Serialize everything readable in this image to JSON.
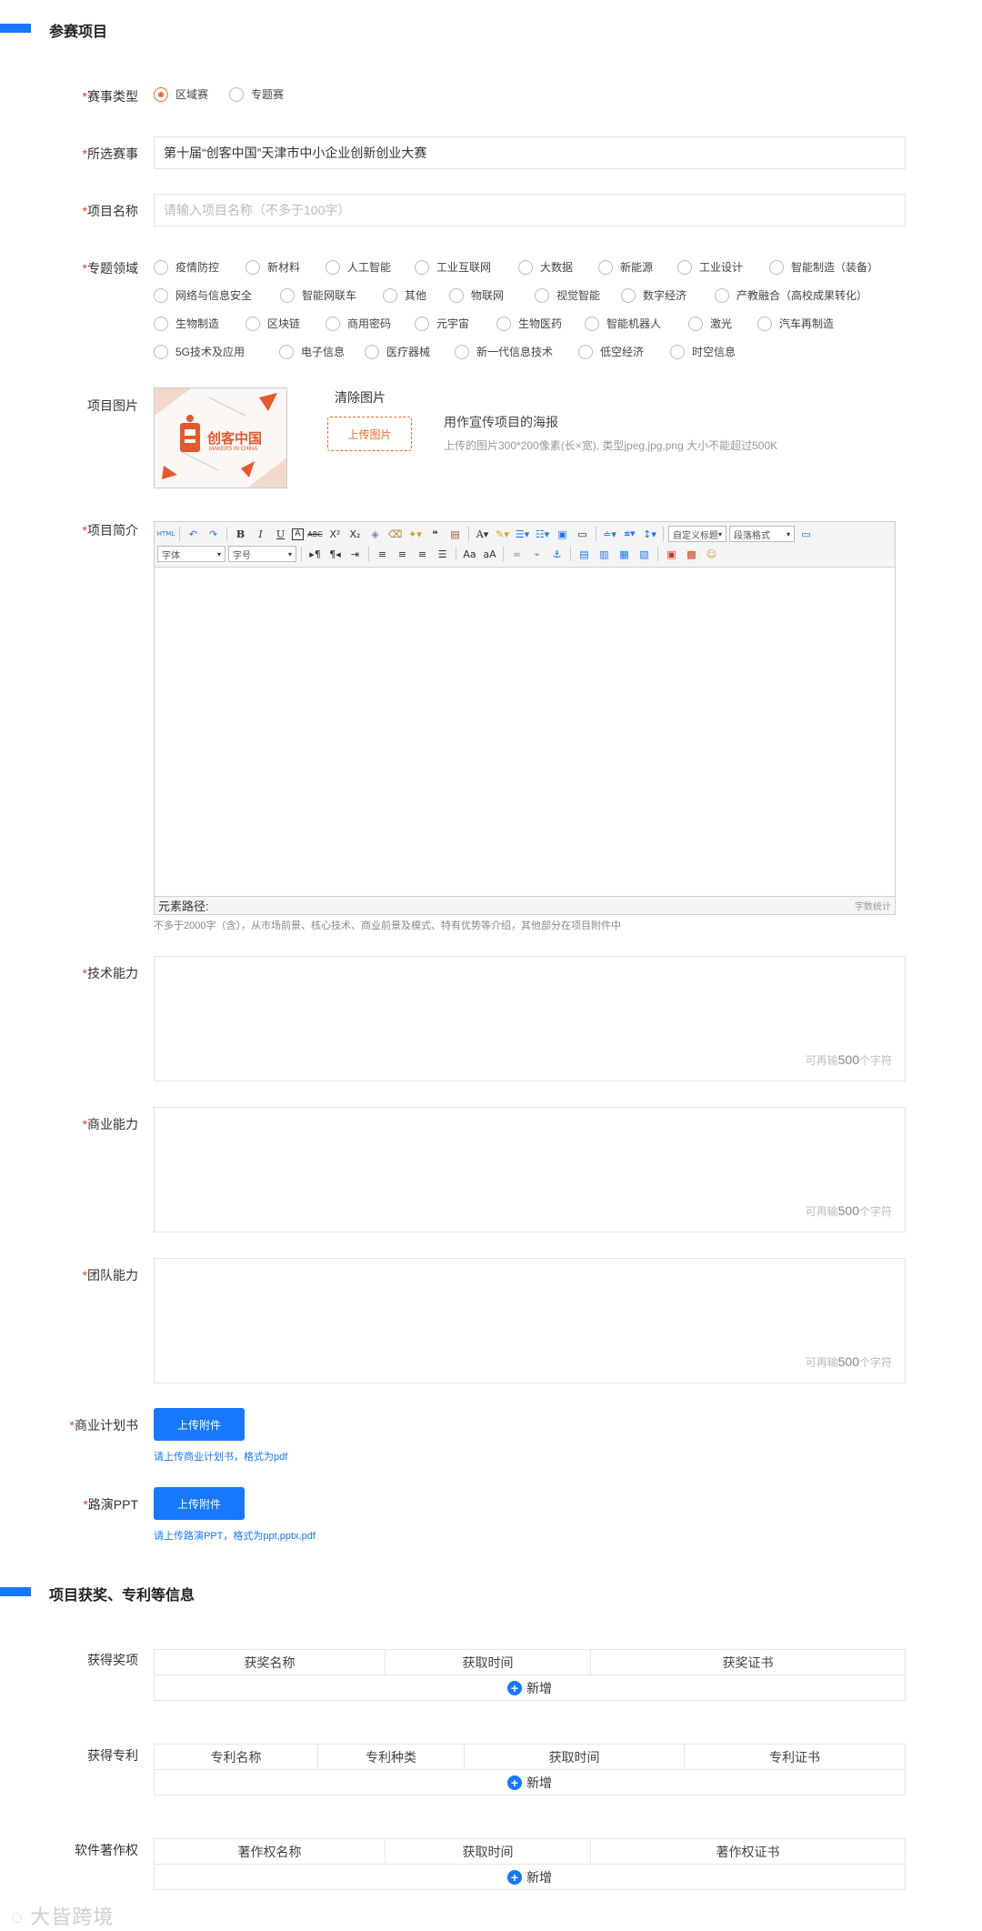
{
  "section1": {
    "title": "参赛项目"
  },
  "required_mark": "*",
  "contest_type": {
    "label": "赛事类型",
    "options": [
      {
        "label": "区域赛",
        "checked": true
      },
      {
        "label": "专题赛",
        "checked": false
      }
    ]
  },
  "selected_contest": {
    "label": "所选赛事",
    "value": "第十届“创客中国”天津市中小企业创新创业大赛"
  },
  "project_name": {
    "label": "项目名称",
    "placeholder": "请输入项目名称（不多于100字）"
  },
  "topic_field": {
    "label": "专题领域",
    "rows": [
      [
        "疫情防控",
        "新材料",
        "人工智能",
        "工业互联网",
        "大数据",
        "新能源",
        "工业设计",
        "智能制造（装备）"
      ],
      [
        "网络与信息安全",
        "智能网联车",
        "其他",
        "物联网",
        "视觉智能",
        "数字经济",
        "产教融合（高校成果转化）"
      ],
      [
        "生物制造",
        "区块链",
        "商用密码",
        "元宇宙",
        "生物医药",
        "智能机器人",
        "激光",
        "汽车再制造"
      ],
      [
        "5G技术及应用",
        "电子信息",
        "医疗器械",
        "新一代信息技术",
        "低空经济",
        "时空信息"
      ]
    ]
  },
  "project_image": {
    "label": "项目图片",
    "logo_text": "创客中国",
    "logo_sub": "MAKERS IN CHINA",
    "clear_label": "清除图片",
    "upload_label": "上传图片",
    "desc_title": "用作宣传项目的海报",
    "desc_hint": "上传的图片300*200像素(长×宽), 类型jpeg,jpg,png 大小不能超过500K"
  },
  "project_intro": {
    "label": "项目简介",
    "font_select": "字体",
    "size_select": "字号",
    "custom_title_select": "自定义标题",
    "paragraph_select": "段落格式",
    "status_path": "元素路径:",
    "word_count": "字数统计",
    "hint": "不多于2000字（含），从市场前景、核心技术、商业前景及模式、特有优势等介绍，其他部分在项目附件中"
  },
  "counter": {
    "prefix": "可再输",
    "number": "500",
    "suffix": "个字符"
  },
  "tech_ability": {
    "label": "技术能力"
  },
  "business_ability": {
    "label": "商业能力"
  },
  "team_ability": {
    "label": "团队能力"
  },
  "business_plan": {
    "label": "商业计划书",
    "button": "上传附件",
    "hint": "请上传商业计划书，格式为pdf"
  },
  "roadshow_ppt": {
    "label": "路演PPT",
    "button": "上传附件",
    "hint": "请上传路演PPT，格式为ppt,pptx,pdf"
  },
  "section2": {
    "title": "项目获奖、专利等信息"
  },
  "awards": {
    "label": "获得奖项",
    "columns": [
      "获奖名称",
      "获取时间",
      "获奖证书"
    ],
    "add_label": "新增"
  },
  "patents": {
    "label": "获得专利",
    "columns": [
      "专利名称",
      "专利种类",
      "获取时间",
      "专利证书"
    ],
    "add_label": "新增"
  },
  "software": {
    "label": "软件著作权",
    "columns": [
      "著作权名称",
      "获取时间",
      "著作权证书"
    ],
    "add_label": "新增"
  },
  "watermark": {
    "text": "大皆跨境"
  }
}
